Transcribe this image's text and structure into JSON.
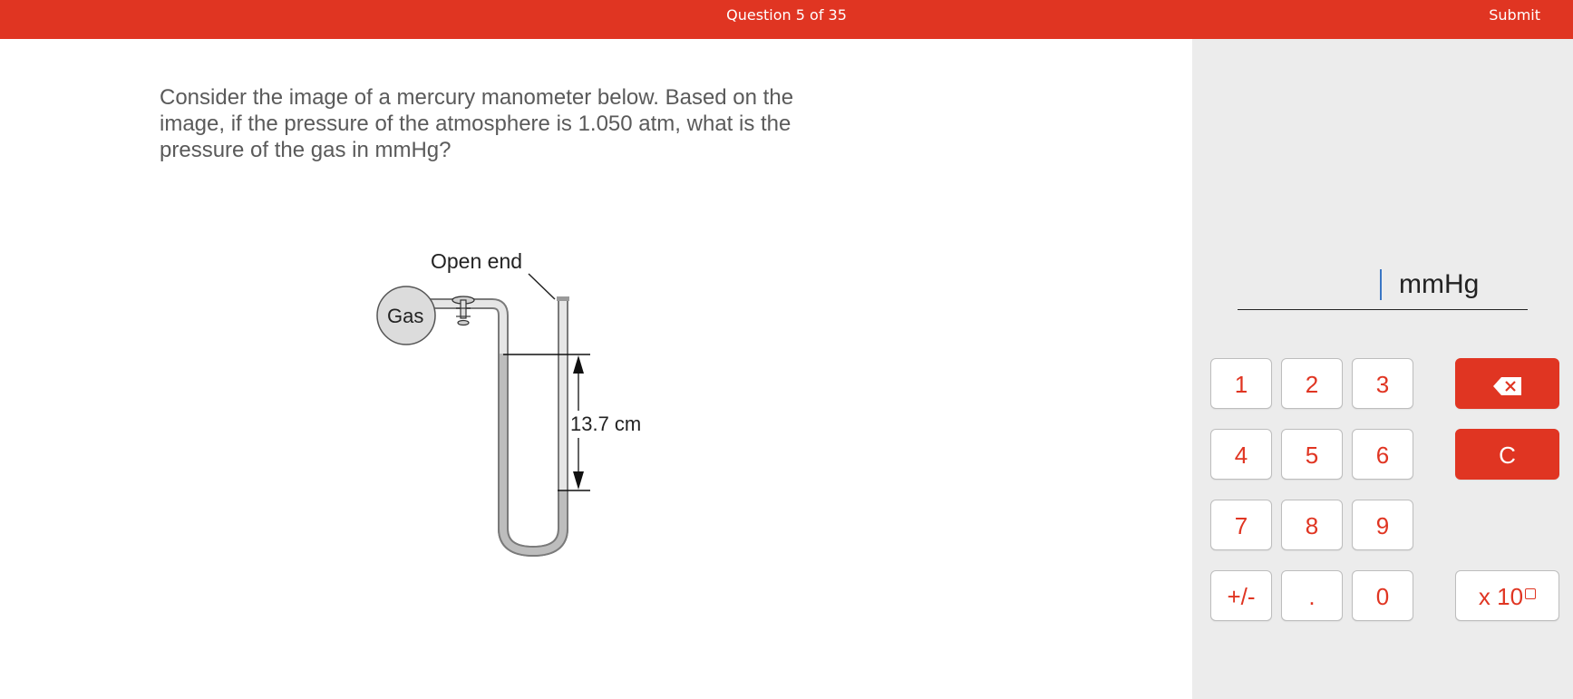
{
  "header": {
    "question_counter": "Question 5 of 35",
    "submit_label": "Submit",
    "bar_color": "#e03522"
  },
  "question": {
    "text": "Consider the image of a mercury manometer below. Based on the image, if the pressure of the atmosphere is 1.050 atm, what is the pressure of the gas in mmHg?"
  },
  "figure": {
    "open_end_label": "Open end",
    "gas_label": "Gas",
    "height_label": "13.7 cm"
  },
  "answer": {
    "value": "",
    "unit": "mmHg"
  },
  "keypad": {
    "keys": [
      "1",
      "2",
      "3",
      "4",
      "5",
      "6",
      "7",
      "8",
      "9",
      "+/-",
      ".",
      "0"
    ],
    "backspace_icon": "backspace-icon",
    "clear_label": "C",
    "sci_label": "x 10",
    "accent_color": "#e03522"
  }
}
